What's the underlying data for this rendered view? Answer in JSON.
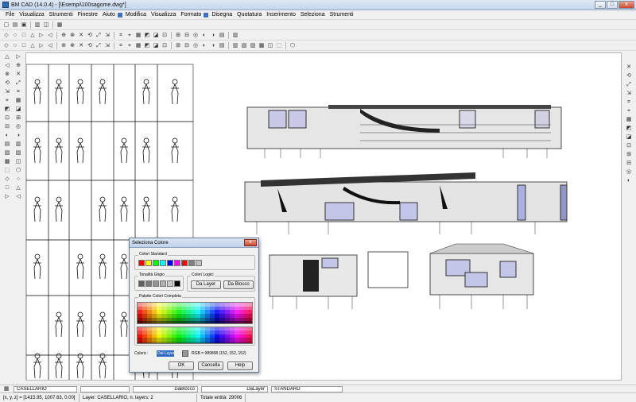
{
  "app": {
    "title": "BM CAD (14.0.4) - [\\Esempi\\100sagome.dwg*]"
  },
  "window_buttons": [
    "_",
    "□",
    "x"
  ],
  "menu": [
    "File",
    "Visualizza",
    "Strumenti",
    "Finestre",
    "Aiuto",
    "Modifica",
    "Visualizza",
    "Formato",
    "Disegna",
    "Quotatura",
    "Inserimento",
    "Seleziona",
    "Strumenti"
  ],
  "toolbar_icons": {
    "row1": [
      "new-icon",
      "open-icon",
      "save-icon",
      "print-icon",
      "preview-icon",
      "publish-icon"
    ],
    "row2": [
      "box-icon",
      "wedge-icon",
      "cone-icon",
      "cylinder-icon",
      "sphere-icon",
      "torus-icon",
      "pyramid-icon",
      "move3d-icon",
      "rotate3d-icon",
      "align-icon",
      "mirror3d-icon",
      "array3d-icon",
      "slice-icon",
      "section-icon",
      "interfere-icon",
      "extrude-icon",
      "revolve-icon",
      "union-icon",
      "subtract-icon",
      "intersect-icon",
      "pan-icon",
      "orbit-icon",
      "zoom-icon",
      "fillet-icon",
      "chamfer-icon"
    ],
    "row3": [
      "zoom-window-icon",
      "zoom-dynamic-icon",
      "zoom-scale-icon",
      "zoom-center-icon",
      "zoom-in-icon",
      "zoom-out-icon",
      "zoom-all-icon",
      "zoom-extents-icon",
      "view-top-icon",
      "view-bottom-icon",
      "view-left-icon",
      "view-right-icon",
      "view-front-icon",
      "view-back-icon",
      "view-iso-sw-icon",
      "view-iso-se-icon",
      "view-iso-ne-icon",
      "view-iso-nw-icon",
      "regen-icon",
      "redraw-icon",
      "pan-realtime-icon",
      "zoom-realtime-icon",
      "zoom-previous-icon",
      "named-views-icon",
      "orbit-3d-icon",
      "camera-icon",
      "walk-icon",
      "fly-icon",
      "render-icon",
      "lights-icon",
      "materials-icon"
    ]
  },
  "status": {
    "layer_name": "CASELLARIO",
    "linetype": "DaBlocco",
    "lineweight": "DaLayer",
    "textstyle": "STANDARD",
    "coords": "[x, y, z] = [1415.95, 1007.63, 0.00]",
    "layer_info": "Layer: CASELLARIO, n. layers: 2",
    "entities": "Totale entità: 29006"
  },
  "dialog": {
    "title": "Seleziona Colore",
    "close": "x",
    "standard_label": "Colori Standard",
    "gray_label": "Tonalità Grigio",
    "logic_label": "Colori Logici",
    "bylayer": "Da Layer",
    "byblock": "Da Blocco",
    "palette_label": "Palette Colori Completa",
    "color_label": "Colore :",
    "color_value": "Dal Layer",
    "rgb_text": "RGB = 989898  (152, 152, 152)",
    "ok": "OK",
    "cancel": "Cancella",
    "help": "Help"
  },
  "colors": {
    "standard": [
      "#ff0000",
      "#ffff00",
      "#00ff00",
      "#00ffff",
      "#0000ff",
      "#ff00ff",
      "#ff0000",
      "#808080",
      "#c0c0c0"
    ],
    "grays": [
      "#606060",
      "#7a7a7a",
      "#959595",
      "#b0b0b0",
      "#cbcbcb",
      "#000000"
    ],
    "selected": "#989898",
    "title_grad": "#bfd1ea",
    "canvas_bg": "#ffffff"
  }
}
